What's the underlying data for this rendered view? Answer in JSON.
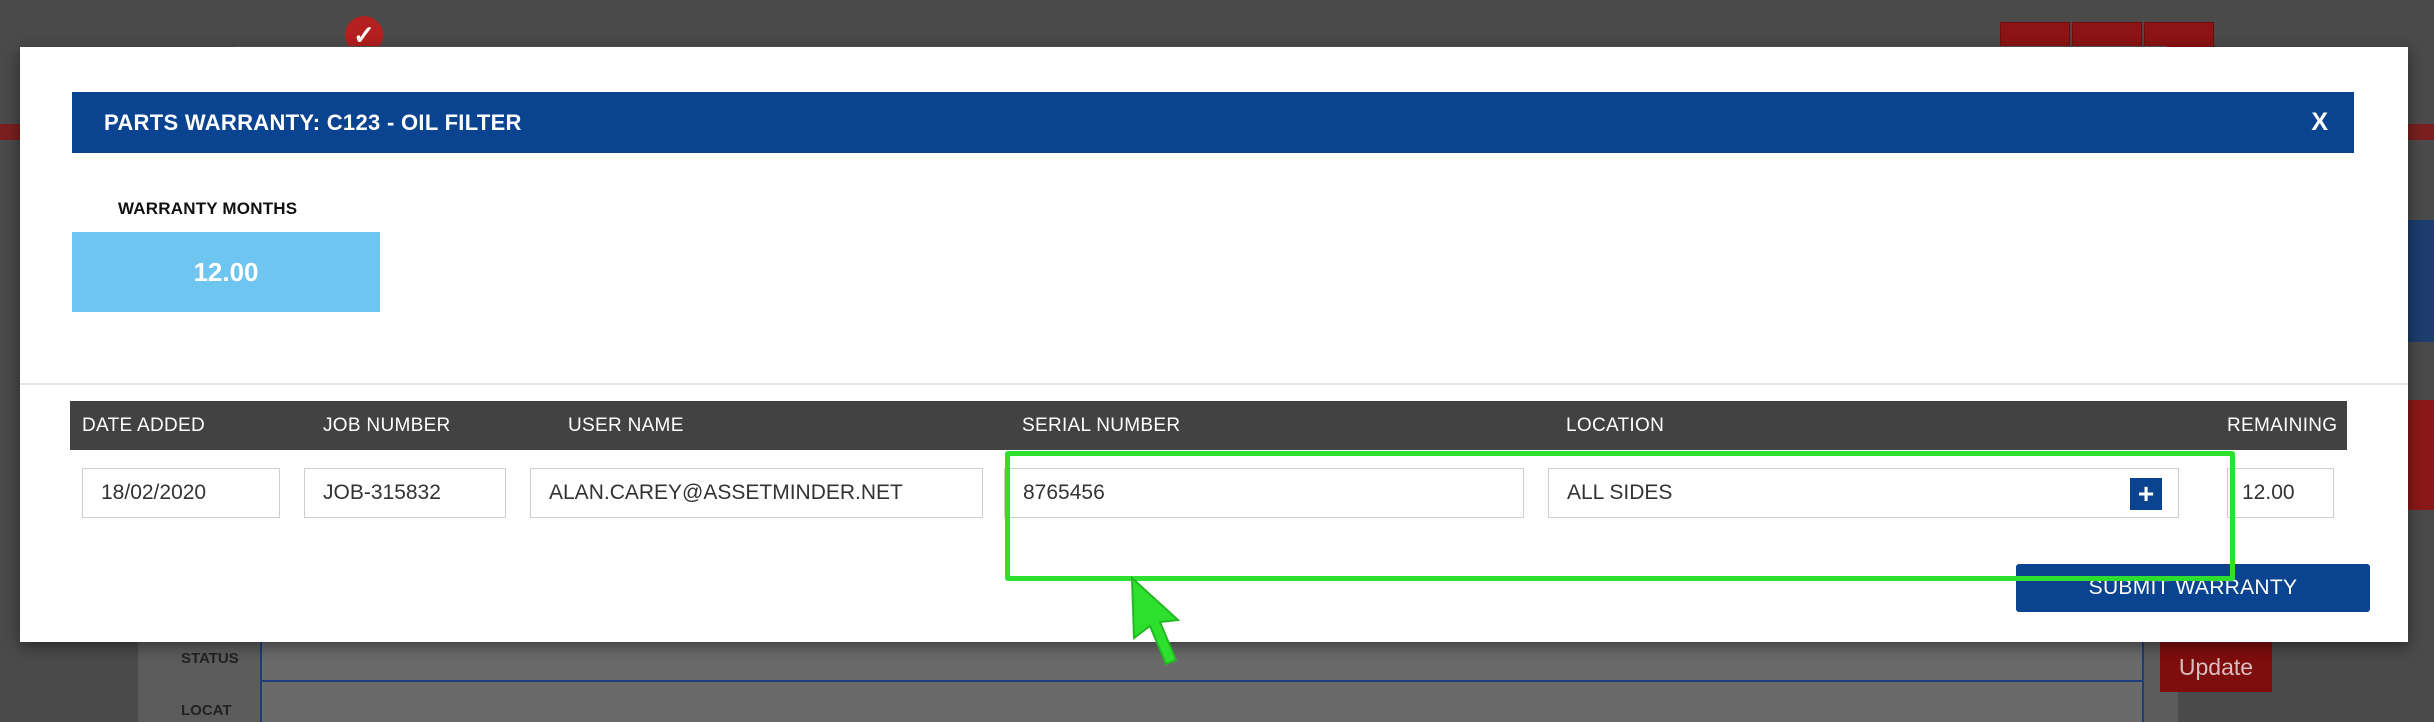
{
  "modal": {
    "title": "PARTS WARRANTY: C123 - OIL FILTER",
    "close_label": "X",
    "warranty_months_label": "WARRANTY MONTHS",
    "warranty_months_value": "12.00",
    "submit_label": "SUBMIT WARRANTY"
  },
  "table": {
    "headers": {
      "date_added": "DATE ADDED",
      "job_number": "JOB NUMBER",
      "user_name": "USER NAME",
      "serial_number": "SERIAL NUMBER",
      "location": "LOCATION",
      "remaining": "REMAINING"
    },
    "row": {
      "date_added": "18/02/2020",
      "job_number": "JOB-315832",
      "user_name": "ALAN.CAREY@ASSETMINDER.NET",
      "serial_number": "8765456",
      "location": "ALL SIDES",
      "remaining": "12.00"
    },
    "add_location_label": "+"
  },
  "background": {
    "status_label": "STATUS",
    "location_label": "LOCAT",
    "update_label": "Update"
  },
  "colors": {
    "header_blue": "#0a4490",
    "warranty_box": "#6ec6f0",
    "table_header": "#424242",
    "highlight_green": "#2ee02e"
  },
  "icons": {
    "add_location": "plus-icon",
    "annotation": "arrow-cursor-icon"
  }
}
